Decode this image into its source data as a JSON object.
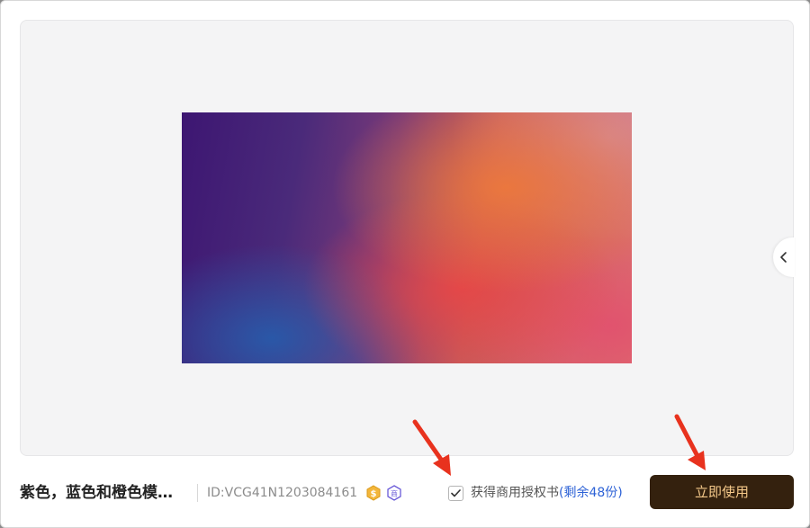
{
  "preview": {
    "collapse_icon": "chevron-left-icon"
  },
  "info": {
    "title": "紫色，蓝色和橙色模糊渐变背景",
    "asset_id": "ID:VCG41N1203084161",
    "badges": [
      {
        "icon": "coin-badge-icon",
        "glyph": "$",
        "color": "#e0a020"
      },
      {
        "icon": "commercial-badge-icon",
        "glyph": "商",
        "color": "#6a5ad8"
      }
    ]
  },
  "license": {
    "checked": true,
    "label": "获得商用授权书",
    "remaining": "(剩余48份)"
  },
  "actions": {
    "use_now_label": "立即使用"
  },
  "colors": {
    "button_bg": "#34210e",
    "button_text": "#f5c98a",
    "link_blue": "#2d62d6",
    "annotation_arrow": "#e8321e"
  }
}
